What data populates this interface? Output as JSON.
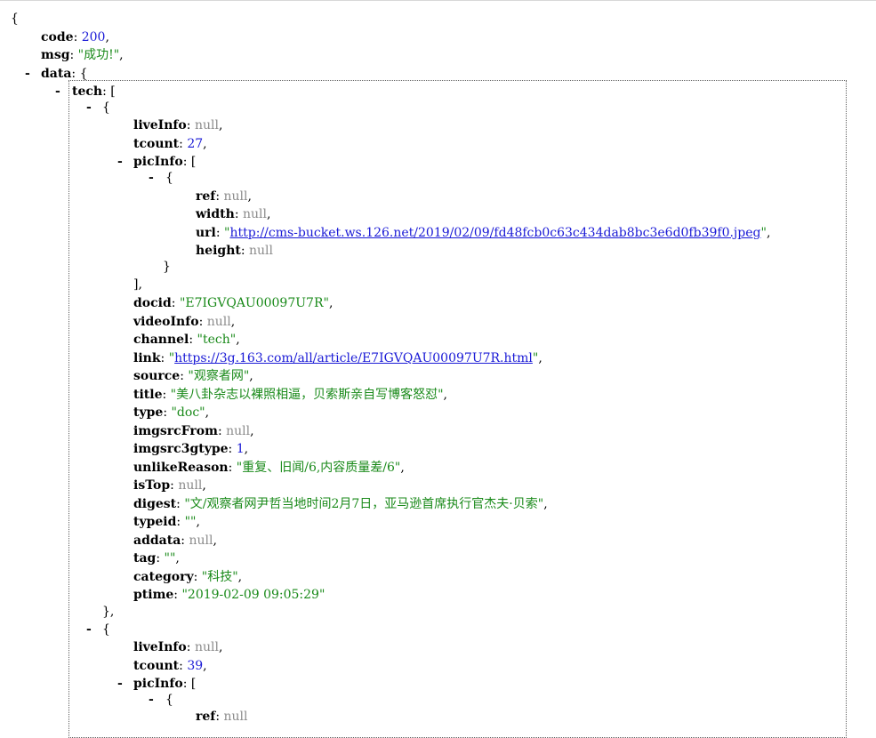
{
  "json_view": {
    "open_brace": "{",
    "code": {
      "key": "code",
      "value": "200"
    },
    "msg": {
      "key": "msg",
      "value": "\"成功!\""
    },
    "data": {
      "key": "data",
      "open": "{"
    },
    "tech": {
      "key": "tech",
      "open": "["
    },
    "toggle": "-",
    "item_open": "{",
    "item_close": "},",
    "pic_open": "{",
    "pic_close": "}",
    "arr_close": "],",
    "items": [
      {
        "liveInfo": {
          "key": "liveInfo",
          "value": "null"
        },
        "tcount": {
          "key": "tcount",
          "value": "27"
        },
        "picInfo": {
          "key": "picInfo",
          "open": "["
        },
        "pic": {
          "ref": {
            "key": "ref",
            "value": "null"
          },
          "width": {
            "key": "width",
            "value": "null"
          },
          "url": {
            "key": "url",
            "value": "http://cms-bucket.ws.126.net/2019/02/09/fd48fcb0c63c434dab8bc3e6d0fb39f0.jpeg"
          },
          "height": {
            "key": "height",
            "value": "null"
          }
        },
        "docid": {
          "key": "docid",
          "value": "\"E7IGVQAU00097U7R\""
        },
        "videoInfo": {
          "key": "videoInfo",
          "value": "null"
        },
        "channel": {
          "key": "channel",
          "value": "\"tech\""
        },
        "link": {
          "key": "link",
          "value": "https://3g.163.com/all/article/E7IGVQAU00097U7R.html"
        },
        "source": {
          "key": "source",
          "value": "\"观察者网\""
        },
        "title": {
          "key": "title",
          "value": "\"美八卦杂志以裸照相逼，贝索斯亲自写博客怒怼\""
        },
        "type": {
          "key": "type",
          "value": "\"doc\""
        },
        "imgsrcFrom": {
          "key": "imgsrcFrom",
          "value": "null"
        },
        "imgsrc3gtype": {
          "key": "imgsrc3gtype",
          "value": "1"
        },
        "unlikeReason": {
          "key": "unlikeReason",
          "value": "\"重复、旧闻/6,内容质量差/6\""
        },
        "isTop": {
          "key": "isTop",
          "value": "null"
        },
        "digest": {
          "key": "digest",
          "value": "\"文/观察者网尹哲当地时间2月7日，亚马逊首席执行官杰夫·贝索\""
        },
        "typeid": {
          "key": "typeid",
          "value": "\"\""
        },
        "addata": {
          "key": "addata",
          "value": "null"
        },
        "tag": {
          "key": "tag",
          "value": "\"\""
        },
        "category": {
          "key": "category",
          "value": "\"科技\""
        },
        "ptime": {
          "key": "ptime",
          "value": "\"2019-02-09 09:05:29\""
        }
      },
      {
        "liveInfo": {
          "key": "liveInfo",
          "value": "null"
        },
        "tcount": {
          "key": "tcount",
          "value": "39"
        },
        "picInfo": {
          "key": "picInfo",
          "open": "["
        },
        "pic": {
          "ref": {
            "key": "ref",
            "value": "null"
          }
        }
      }
    ]
  }
}
